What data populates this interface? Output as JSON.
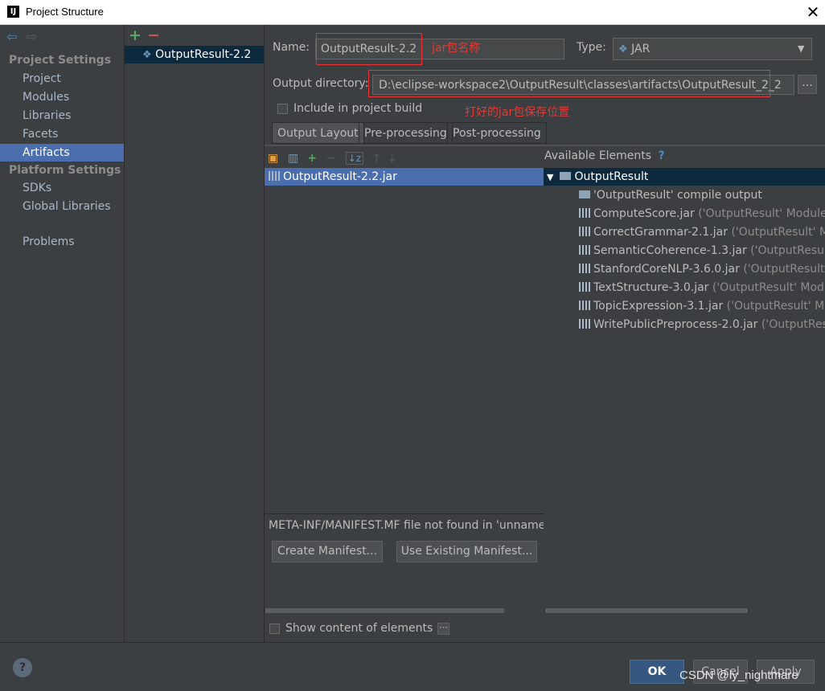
{
  "window": {
    "title": "Project Structure",
    "logo": "IJ"
  },
  "left_nav": {
    "project_settings_head": "Project Settings",
    "project_items": [
      "Project",
      "Modules",
      "Libraries",
      "Facets",
      "Artifacts"
    ],
    "selected": "Artifacts",
    "platform_settings_head": "Platform Settings",
    "platform_items": [
      "SDKs",
      "Global Libraries"
    ],
    "problems": "Problems"
  },
  "artifacts_list": {
    "items": [
      "OutputResult-2.2"
    ]
  },
  "details": {
    "name_label": "Name:",
    "name_value": "OutputResult-2.2",
    "name_note": "jar包名称",
    "type_label": "Type:",
    "type_value": "JAR",
    "output_dir_label": "Output directory:",
    "output_dir_value": "D:\\eclipse-workspace2\\OutputResult\\classes\\artifacts\\OutputResult_2_2",
    "browse": "...",
    "include_build": "Include in project build",
    "dir_note": "打好的jar包保存位置"
  },
  "tabs": [
    "Output Layout",
    "Pre-processing",
    "Post-processing"
  ],
  "output_layout": {
    "root": "OutputResult-2.2.jar",
    "manifest_msg": "META-INF/MANIFEST.MF file not found in 'unname",
    "create_manifest": "Create Manifest...",
    "use_existing": "Use Existing Manifest..."
  },
  "available": {
    "header": "Available Elements",
    "help": "?",
    "root": "OutputResult",
    "items": [
      {
        "name": "'OutputResult' compile output",
        "note": ""
      },
      {
        "name": "ComputeScore.jar",
        "note": "('OutputResult' Module"
      },
      {
        "name": "CorrectGrammar-2.1.jar",
        "note": "('OutputResult' Mo"
      },
      {
        "name": "SemanticCoherence-1.3.jar",
        "note": "('OutputResult'"
      },
      {
        "name": "StanfordCoreNLP-3.6.0.jar",
        "note": "('OutputResult' M"
      },
      {
        "name": "TextStructure-3.0.jar",
        "note": "('OutputResult' Modul"
      },
      {
        "name": "TopicExpression-3.1.jar",
        "note": "('OutputResult' Mo"
      },
      {
        "name": "WritePublicPreprocess-2.0.jar",
        "note": "('OutputResu"
      }
    ]
  },
  "show_content": "Show content of elements",
  "footer": {
    "help": "?",
    "ok": "OK",
    "cancel": "Cancel",
    "apply": "Apply",
    "watermark": "CSDN @ly_nightmare"
  }
}
